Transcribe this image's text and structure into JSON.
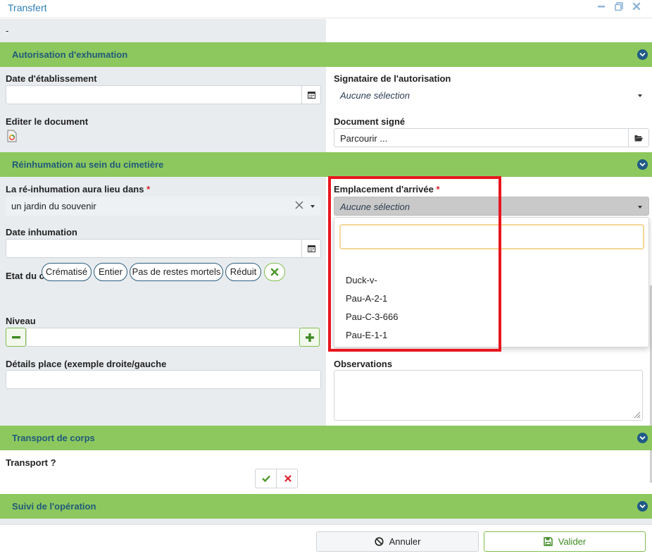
{
  "window": {
    "title": "Transfert",
    "controls": [
      "minimize-icon",
      "restore-icon",
      "close-icon"
    ]
  },
  "top_value": "-",
  "sections": {
    "autorisation": "Autorisation d'exhumation",
    "reinhumation": "Réinhumation au sein du cimetière",
    "transport": "Transport de corps",
    "suivi": "Suivi de l'opération"
  },
  "autorisation": {
    "date_label": "Date d'établissement",
    "date_value": "",
    "signataire_label": "Signataire de l'autorisation",
    "signataire_value": "Aucune sélection",
    "editer_label": "Editer le document",
    "document_label": "Document signé",
    "document_value": "Parcourir ..."
  },
  "reinhumation": {
    "lieu_label": "La ré-inhumation aura lieu dans",
    "lieu_value": "un jardin du souvenir",
    "emplacement_label": "Emplacement d'arrivée",
    "emplacement_value": "Aucune sélection",
    "required_mark": "*",
    "date_label": "Date inhumation",
    "date_value": "",
    "etat_label": "Etat du corps",
    "etat_options": [
      "Crématisé",
      "Entier",
      "Pas de restes mortels",
      "Réduit"
    ],
    "niveau_label": "Niveau",
    "niveau_value": "",
    "details_label": "Détails place (exemple droite/gauche",
    "details_value": "",
    "observations_label": "Observations",
    "observations_value": ""
  },
  "dropdown": {
    "search_value": "",
    "options": [
      "Duck-v-",
      "Pau-A-2-1",
      "Pau-C-3-666",
      "Pau-E-1-1"
    ]
  },
  "transport": {
    "label": "Transport ?"
  },
  "footer": {
    "cancel_label": "Annuler",
    "submit_label": "Valider"
  },
  "colors": {
    "section_green": "#8dc85e",
    "section_text": "#215a7a",
    "highlight_red": "#e8161f",
    "accent_blue": "#2f7fb8"
  }
}
